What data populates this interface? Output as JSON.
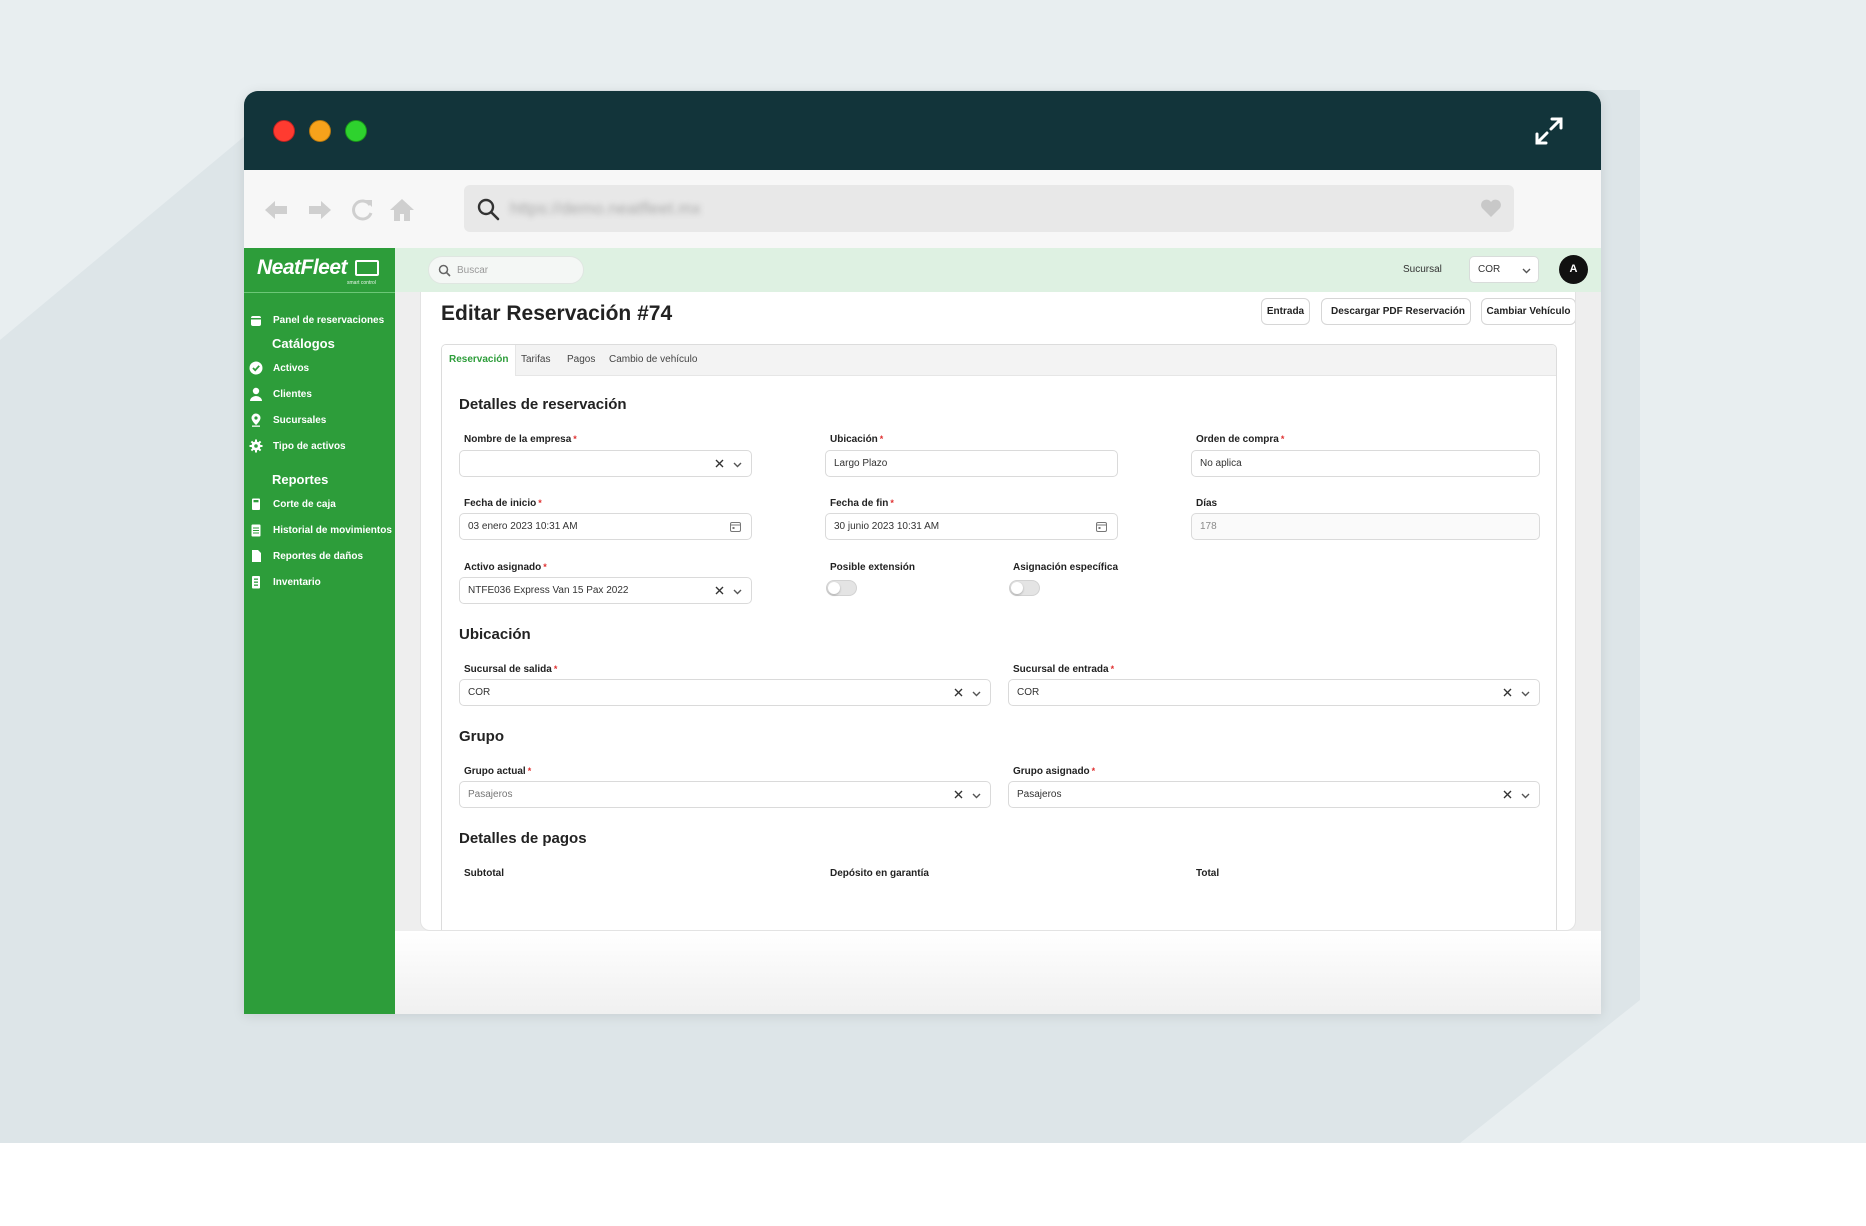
{
  "browser": {
    "url": "https://demo.neatfleet.mx"
  },
  "sidebar": {
    "logo_text": "NeatFleet",
    "logo_tagline": "smart control",
    "items": [
      {
        "label": "Panel de reservaciones",
        "icon": "calendar-icon"
      },
      {
        "label": "Activos",
        "icon": "check-circle-icon"
      },
      {
        "label": "Clientes",
        "icon": "user-icon"
      },
      {
        "label": "Sucursales",
        "icon": "location-pin-icon"
      },
      {
        "label": "Tipo de activos",
        "icon": "gear-icon"
      },
      {
        "label": "Corte de caja",
        "icon": "register-icon"
      },
      {
        "label": "Historial de movimientos",
        "icon": "clipboard-icon"
      },
      {
        "label": "Reportes de daños",
        "icon": "document-icon"
      },
      {
        "label": "Inventario",
        "icon": "inventory-icon"
      }
    ],
    "sections": {
      "catalogos": "Catálogos",
      "reportes": "Reportes"
    }
  },
  "topbar": {
    "search_placeholder": "Buscar",
    "sucursal_label": "Sucursal",
    "sucursal_value": "COR",
    "avatar_initial": "A"
  },
  "page": {
    "title": "Editar Reservación #74",
    "buttons": {
      "entrada": "Entrada",
      "pdf": "Descargar PDF Reservación",
      "cambiar": "Cambiar Vehículo"
    }
  },
  "tabs": [
    "Reservación",
    "Tarifas",
    "Pagos",
    "Cambio de vehículo"
  ],
  "form": {
    "detalles": {
      "title": "Detalles de reservación",
      "empresa_label": "Nombre de la empresa",
      "empresa_value": "",
      "ubicacion_label": "Ubicación",
      "ubicacion_value": "Largo Plazo",
      "orden_label": "Orden de compra",
      "orden_value": "No aplica",
      "inicio_label": "Fecha de inicio",
      "inicio_value": "03 enero 2023 10:31 AM",
      "fin_label": "Fecha de fin",
      "fin_value": "30 junio 2023 10:31 AM",
      "dias_label": "Días",
      "dias_value": "178",
      "activo_label": "Activo asignado",
      "activo_value": "NTFE036 Express Van 15 Pax 2022",
      "extension_label": "Posible extensión",
      "asignacion_label": "Asignación específica"
    },
    "ubicacion": {
      "title": "Ubicación",
      "salida_label": "Sucursal de salida",
      "salida_value": "COR",
      "entrada_label": "Sucursal de entrada",
      "entrada_value": "COR"
    },
    "grupo": {
      "title": "Grupo",
      "actual_label": "Grupo actual",
      "actual_value": "Pasajeros",
      "asignado_label": "Grupo asignado",
      "asignado_value": "Pasajeros"
    },
    "pagos": {
      "title": "Detalles de pagos",
      "subtotal_label": "Subtotal",
      "deposito_label": "Depósito en garantía",
      "total_label": "Total"
    }
  },
  "colors": {
    "sidebar_green": "#2d9d3a",
    "titlebar_dark": "#12343a",
    "topbar_tint": "#def1e2",
    "required": "#e03030"
  }
}
